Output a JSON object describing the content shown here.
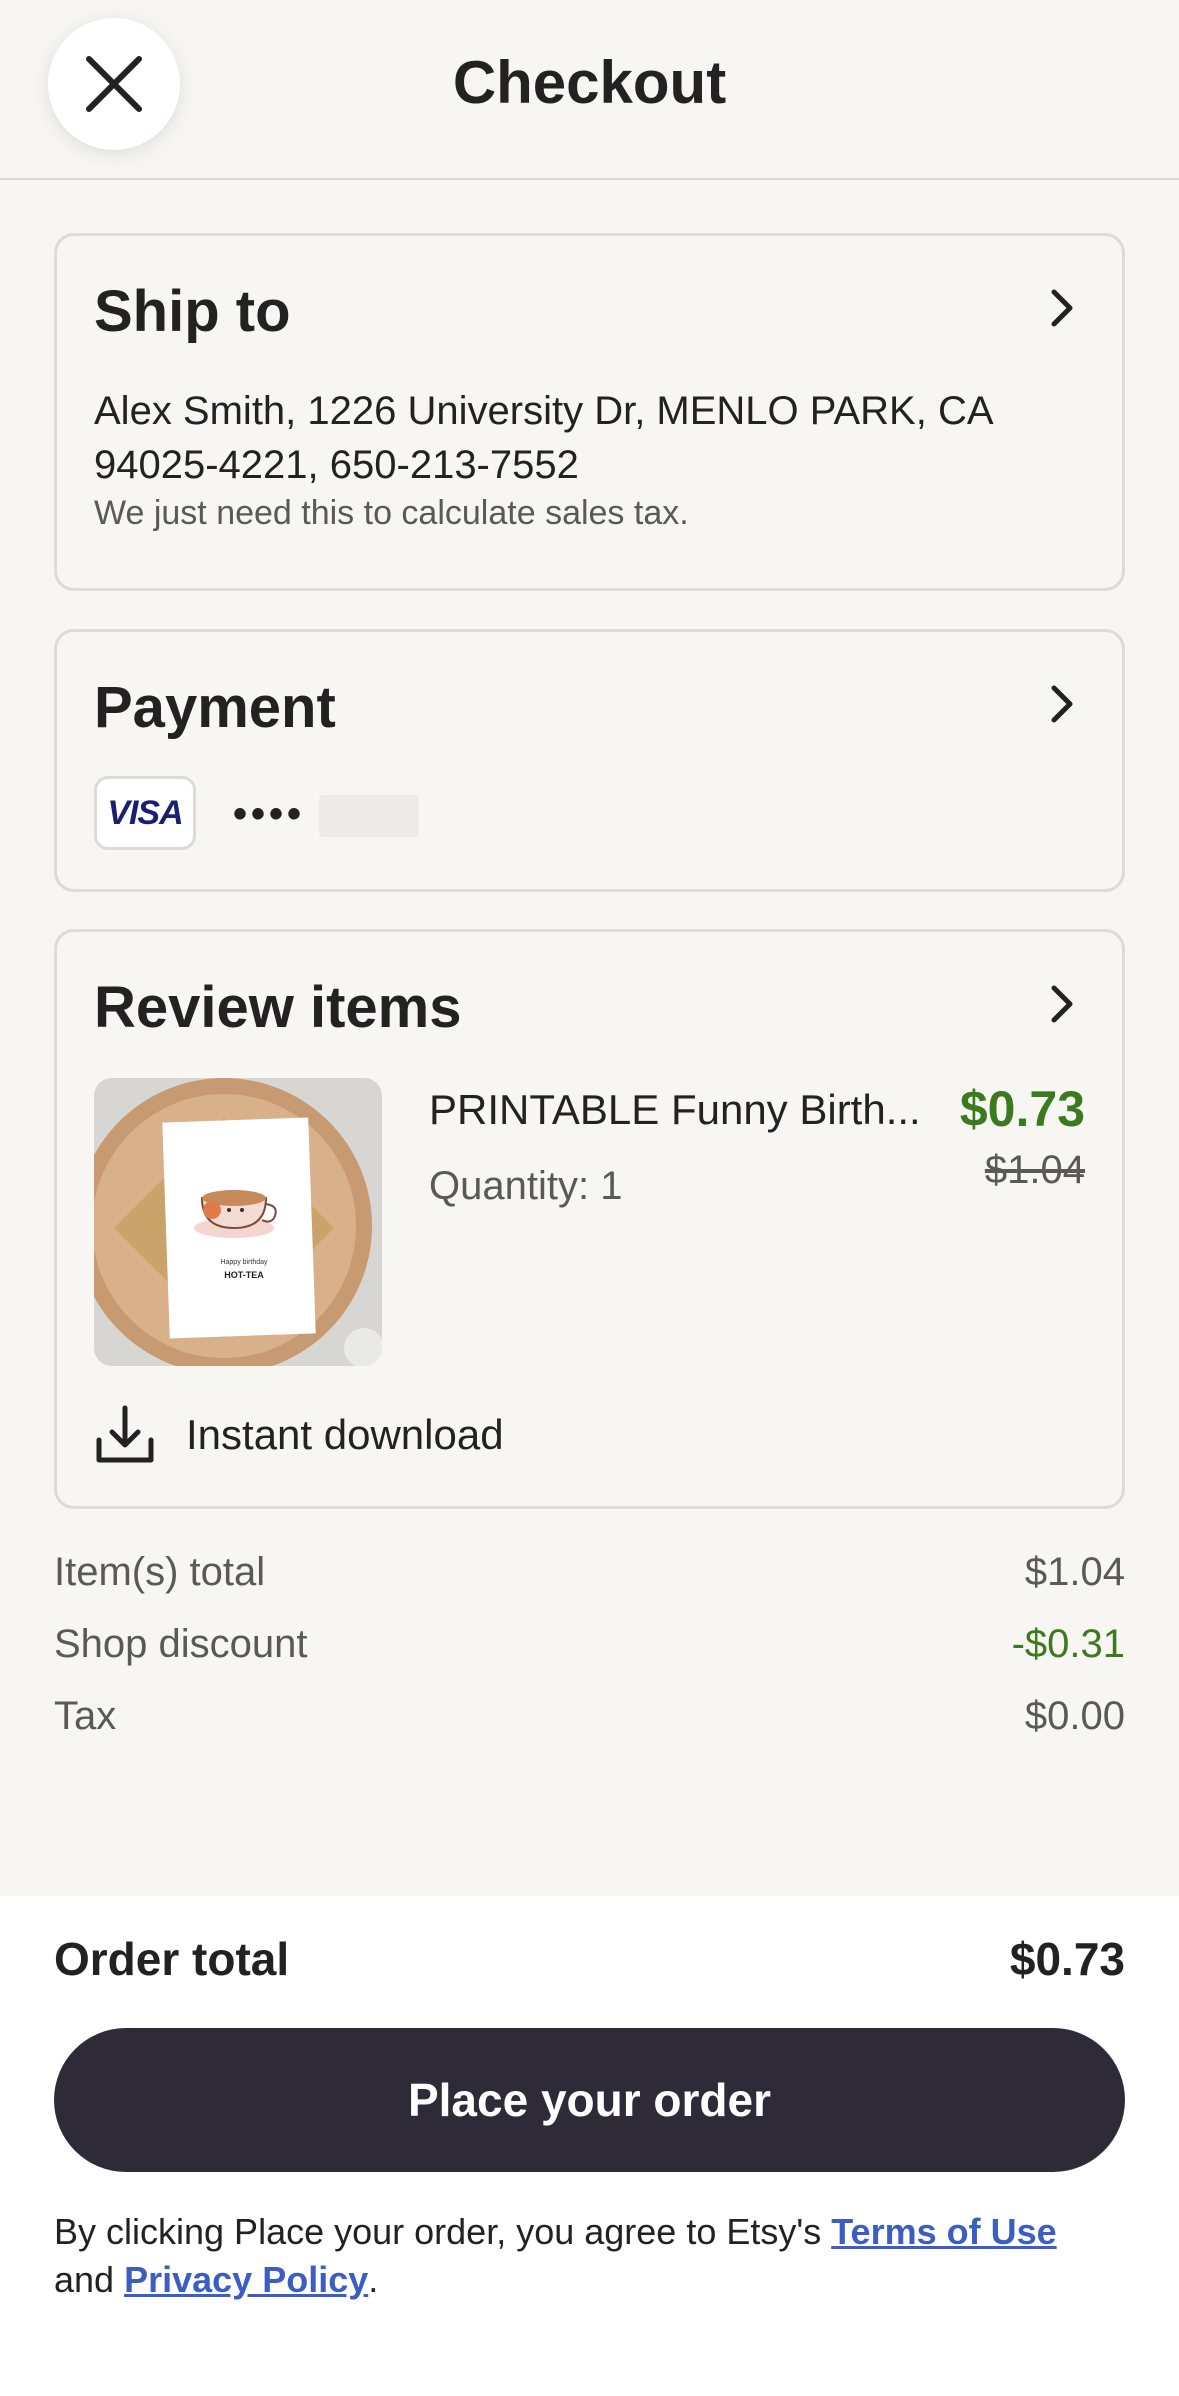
{
  "header": {
    "title": "Checkout",
    "close_icon": "close-icon"
  },
  "ship_to": {
    "title": "Ship to",
    "address": "Alex Smith, 1226 University Dr, MENLO PARK, CA 94025-4221, 650-213-7552",
    "note": "We just need this to calculate sales tax."
  },
  "payment": {
    "title": "Payment",
    "card_brand": "VISA",
    "card_mask": "••••"
  },
  "review": {
    "title": "Review items",
    "item": {
      "title": "PRINTABLE Funny Birth...",
      "quantity": "Quantity: 1",
      "price": "$0.73",
      "original_price": "$1.04",
      "image_text_line1": "Happy birthday",
      "image_text_line2": "HOT-TEA"
    },
    "download_label": "Instant download"
  },
  "summary": {
    "items_total_label": "Item(s) total",
    "items_total_value": "$1.04",
    "discount_label": "Shop discount",
    "discount_value": "-$0.31",
    "tax_label": "Tax",
    "tax_value": "$0.00"
  },
  "footer": {
    "order_total_label": "Order total",
    "order_total_value": "$0.73",
    "place_order_label": "Place your order",
    "legal_prefix": "By clicking Place your order, you agree to Etsy's ",
    "terms_label": "Terms of Use",
    "legal_mid": " and ",
    "privacy_label": "Privacy Policy",
    "legal_suffix": "."
  },
  "colors": {
    "background": "#f7f6f3",
    "accent_green": "#3b7a1e",
    "button_dark": "#2f2a38",
    "link_blue": "#3b5ec4"
  }
}
